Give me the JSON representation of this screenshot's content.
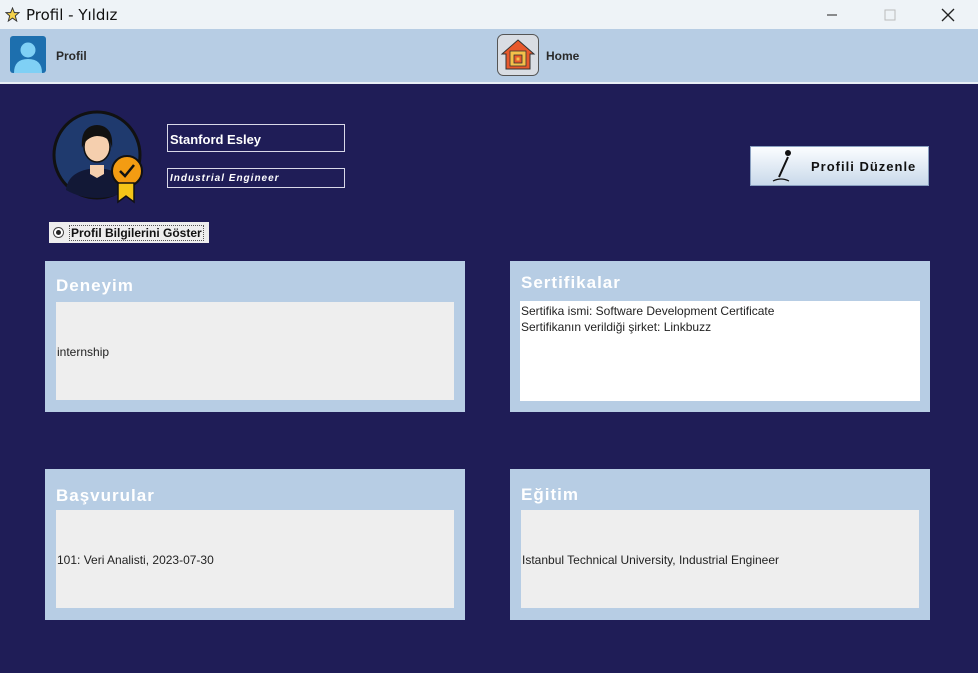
{
  "window": {
    "title": "Profil - Yıldız"
  },
  "nav": {
    "profile_label": "Profil",
    "home_label": "Home"
  },
  "profile": {
    "name": "Stanford Esley",
    "job_title": "Industrial Engineer",
    "edit_label": "Profili Düzenle",
    "show_info_label": "Profil Bilgilerini Göster",
    "show_info_checked": true
  },
  "sections": {
    "experience": {
      "title": "Deneyim",
      "content": "internship"
    },
    "certificates": {
      "title": "Sertifikalar",
      "lines": [
        "Sertifika ismi: Software Development Certificate",
        "Sertifikanın verildiği şirket: Linkbuzz"
      ]
    },
    "applications": {
      "title": "Başvurular",
      "content": "101: Veri Analisti, 2023-07-30"
    },
    "education": {
      "title": "Eğitim",
      "content": "Istanbul Technical University, Industrial Engineer"
    }
  },
  "colors": {
    "background": "#1f1d57",
    "panel": "#b7cde4",
    "navbar": "#b7cde4"
  }
}
